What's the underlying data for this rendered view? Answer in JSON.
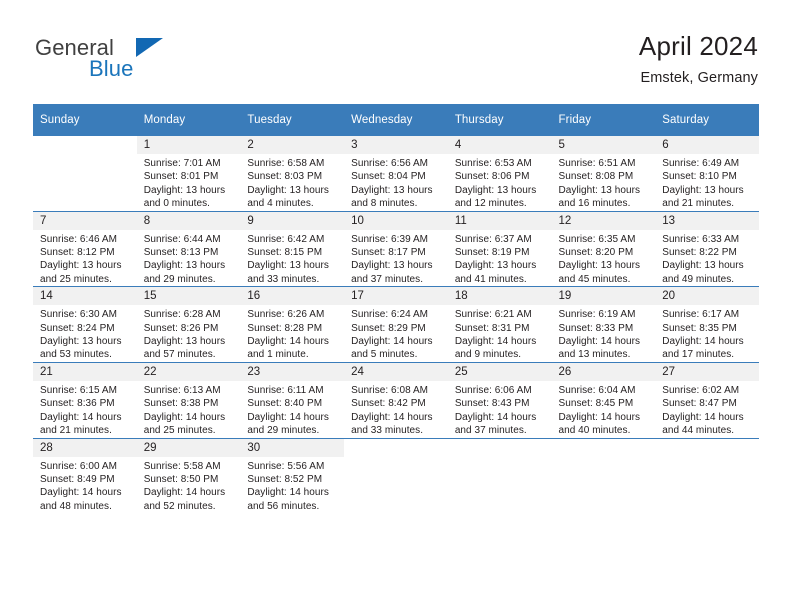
{
  "brand": {
    "name_top": "General",
    "name_bottom": "Blue",
    "triangle_color": "#1268b3",
    "blue_color": "#1b75bb"
  },
  "header": {
    "title": "April 2024",
    "location": "Emstek, Germany"
  },
  "theme": {
    "header_bg": "#3a7cba",
    "daynum_bg": "#f1f1f1",
    "text": "#231f20"
  },
  "weekday_headers": [
    "Sunday",
    "Monday",
    "Tuesday",
    "Wednesday",
    "Thursday",
    "Friday",
    "Saturday"
  ],
  "weeks": [
    [
      {
        "day": "",
        "blank": true
      },
      {
        "day": "1",
        "sunrise": "Sunrise: 7:01 AM",
        "sunset": "Sunset: 8:01 PM",
        "daylight1": "Daylight: 13 hours",
        "daylight2": "and 0 minutes."
      },
      {
        "day": "2",
        "sunrise": "Sunrise: 6:58 AM",
        "sunset": "Sunset: 8:03 PM",
        "daylight1": "Daylight: 13 hours",
        "daylight2": "and 4 minutes."
      },
      {
        "day": "3",
        "sunrise": "Sunrise: 6:56 AM",
        "sunset": "Sunset: 8:04 PM",
        "daylight1": "Daylight: 13 hours",
        "daylight2": "and 8 minutes."
      },
      {
        "day": "4",
        "sunrise": "Sunrise: 6:53 AM",
        "sunset": "Sunset: 8:06 PM",
        "daylight1": "Daylight: 13 hours",
        "daylight2": "and 12 minutes."
      },
      {
        "day": "5",
        "sunrise": "Sunrise: 6:51 AM",
        "sunset": "Sunset: 8:08 PM",
        "daylight1": "Daylight: 13 hours",
        "daylight2": "and 16 minutes."
      },
      {
        "day": "6",
        "sunrise": "Sunrise: 6:49 AM",
        "sunset": "Sunset: 8:10 PM",
        "daylight1": "Daylight: 13 hours",
        "daylight2": "and 21 minutes."
      }
    ],
    [
      {
        "day": "7",
        "sunrise": "Sunrise: 6:46 AM",
        "sunset": "Sunset: 8:12 PM",
        "daylight1": "Daylight: 13 hours",
        "daylight2": "and 25 minutes."
      },
      {
        "day": "8",
        "sunrise": "Sunrise: 6:44 AM",
        "sunset": "Sunset: 8:13 PM",
        "daylight1": "Daylight: 13 hours",
        "daylight2": "and 29 minutes."
      },
      {
        "day": "9",
        "sunrise": "Sunrise: 6:42 AM",
        "sunset": "Sunset: 8:15 PM",
        "daylight1": "Daylight: 13 hours",
        "daylight2": "and 33 minutes."
      },
      {
        "day": "10",
        "sunrise": "Sunrise: 6:39 AM",
        "sunset": "Sunset: 8:17 PM",
        "daylight1": "Daylight: 13 hours",
        "daylight2": "and 37 minutes."
      },
      {
        "day": "11",
        "sunrise": "Sunrise: 6:37 AM",
        "sunset": "Sunset: 8:19 PM",
        "daylight1": "Daylight: 13 hours",
        "daylight2": "and 41 minutes."
      },
      {
        "day": "12",
        "sunrise": "Sunrise: 6:35 AM",
        "sunset": "Sunset: 8:20 PM",
        "daylight1": "Daylight: 13 hours",
        "daylight2": "and 45 minutes."
      },
      {
        "day": "13",
        "sunrise": "Sunrise: 6:33 AM",
        "sunset": "Sunset: 8:22 PM",
        "daylight1": "Daylight: 13 hours",
        "daylight2": "and 49 minutes."
      }
    ],
    [
      {
        "day": "14",
        "sunrise": "Sunrise: 6:30 AM",
        "sunset": "Sunset: 8:24 PM",
        "daylight1": "Daylight: 13 hours",
        "daylight2": "and 53 minutes."
      },
      {
        "day": "15",
        "sunrise": "Sunrise: 6:28 AM",
        "sunset": "Sunset: 8:26 PM",
        "daylight1": "Daylight: 13 hours",
        "daylight2": "and 57 minutes."
      },
      {
        "day": "16",
        "sunrise": "Sunrise: 6:26 AM",
        "sunset": "Sunset: 8:28 PM",
        "daylight1": "Daylight: 14 hours",
        "daylight2": "and 1 minute."
      },
      {
        "day": "17",
        "sunrise": "Sunrise: 6:24 AM",
        "sunset": "Sunset: 8:29 PM",
        "daylight1": "Daylight: 14 hours",
        "daylight2": "and 5 minutes."
      },
      {
        "day": "18",
        "sunrise": "Sunrise: 6:21 AM",
        "sunset": "Sunset: 8:31 PM",
        "daylight1": "Daylight: 14 hours",
        "daylight2": "and 9 minutes."
      },
      {
        "day": "19",
        "sunrise": "Sunrise: 6:19 AM",
        "sunset": "Sunset: 8:33 PM",
        "daylight1": "Daylight: 14 hours",
        "daylight2": "and 13 minutes."
      },
      {
        "day": "20",
        "sunrise": "Sunrise: 6:17 AM",
        "sunset": "Sunset: 8:35 PM",
        "daylight1": "Daylight: 14 hours",
        "daylight2": "and 17 minutes."
      }
    ],
    [
      {
        "day": "21",
        "sunrise": "Sunrise: 6:15 AM",
        "sunset": "Sunset: 8:36 PM",
        "daylight1": "Daylight: 14 hours",
        "daylight2": "and 21 minutes."
      },
      {
        "day": "22",
        "sunrise": "Sunrise: 6:13 AM",
        "sunset": "Sunset: 8:38 PM",
        "daylight1": "Daylight: 14 hours",
        "daylight2": "and 25 minutes."
      },
      {
        "day": "23",
        "sunrise": "Sunrise: 6:11 AM",
        "sunset": "Sunset: 8:40 PM",
        "daylight1": "Daylight: 14 hours",
        "daylight2": "and 29 minutes."
      },
      {
        "day": "24",
        "sunrise": "Sunrise: 6:08 AM",
        "sunset": "Sunset: 8:42 PM",
        "daylight1": "Daylight: 14 hours",
        "daylight2": "and 33 minutes."
      },
      {
        "day": "25",
        "sunrise": "Sunrise: 6:06 AM",
        "sunset": "Sunset: 8:43 PM",
        "daylight1": "Daylight: 14 hours",
        "daylight2": "and 37 minutes."
      },
      {
        "day": "26",
        "sunrise": "Sunrise: 6:04 AM",
        "sunset": "Sunset: 8:45 PM",
        "daylight1": "Daylight: 14 hours",
        "daylight2": "and 40 minutes."
      },
      {
        "day": "27",
        "sunrise": "Sunrise: 6:02 AM",
        "sunset": "Sunset: 8:47 PM",
        "daylight1": "Daylight: 14 hours",
        "daylight2": "and 44 minutes."
      }
    ],
    [
      {
        "day": "28",
        "sunrise": "Sunrise: 6:00 AM",
        "sunset": "Sunset: 8:49 PM",
        "daylight1": "Daylight: 14 hours",
        "daylight2": "and 48 minutes."
      },
      {
        "day": "29",
        "sunrise": "Sunrise: 5:58 AM",
        "sunset": "Sunset: 8:50 PM",
        "daylight1": "Daylight: 14 hours",
        "daylight2": "and 52 minutes."
      },
      {
        "day": "30",
        "sunrise": "Sunrise: 5:56 AM",
        "sunset": "Sunset: 8:52 PM",
        "daylight1": "Daylight: 14 hours",
        "daylight2": "and 56 minutes."
      },
      {
        "day": "",
        "blank": true
      },
      {
        "day": "",
        "blank": true
      },
      {
        "day": "",
        "blank": true
      },
      {
        "day": "",
        "blank": true
      }
    ]
  ]
}
